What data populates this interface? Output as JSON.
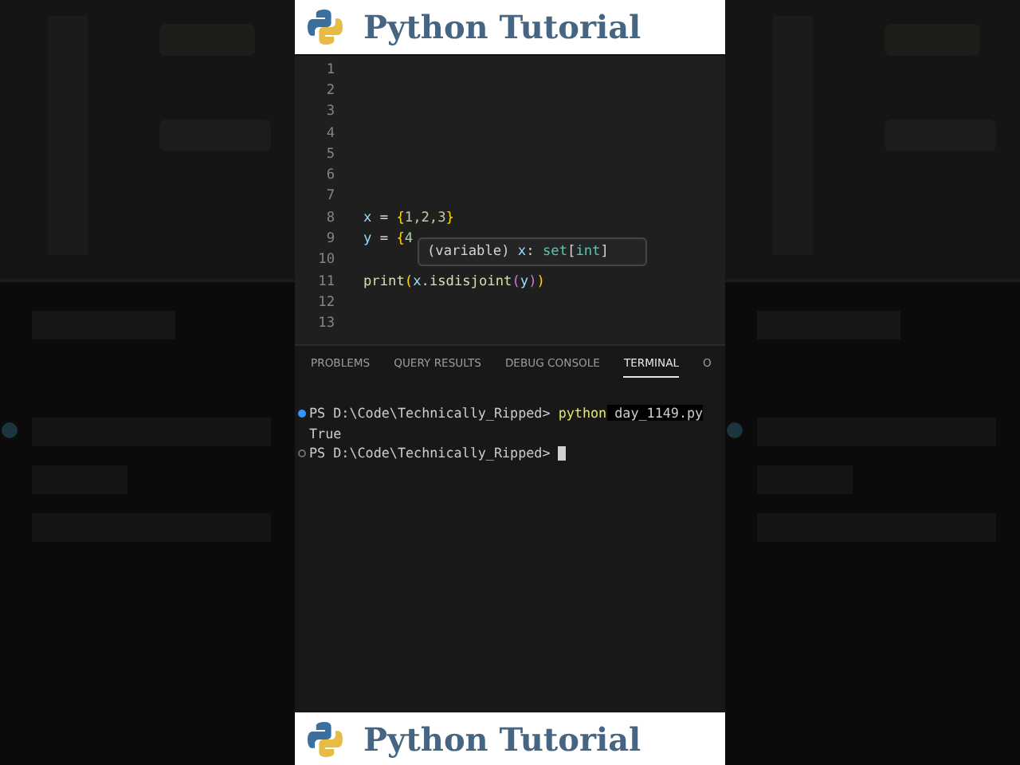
{
  "banner_top": {
    "title": "Python Tutorial"
  },
  "editor": {
    "lines": [
      {
        "number": "1"
      },
      {
        "number": "2"
      },
      {
        "number": "3"
      },
      {
        "number": "4"
      },
      {
        "number": "5"
      },
      {
        "number": "6"
      },
      {
        "number": "7"
      },
      {
        "number": "8",
        "tokens": [
          {
            "text": "x",
            "kind": "var"
          },
          {
            "text": " = ",
            "kind": "op"
          },
          {
            "text": "{",
            "kind": "brace"
          },
          {
            "text": "1,2,3",
            "kind": "num"
          },
          {
            "text": "}",
            "kind": "brace"
          }
        ]
      },
      {
        "number": "9",
        "tokens": [
          {
            "text": "y",
            "kind": "var"
          },
          {
            "text": " = ",
            "kind": "op"
          },
          {
            "text": "{",
            "kind": "brace"
          },
          {
            "text": "4",
            "kind": "num"
          }
        ]
      },
      {
        "number": "10"
      },
      {
        "number": "11",
        "tokens": [
          {
            "text": "print",
            "kind": "func"
          },
          {
            "text": "(",
            "kind": "brace"
          },
          {
            "text": "x",
            "kind": "var"
          },
          {
            "text": ".",
            "kind": "op"
          },
          {
            "text": "isdisjoint",
            "kind": "func"
          },
          {
            "text": "(",
            "kind": "paren"
          },
          {
            "text": "y",
            "kind": "var"
          },
          {
            "text": ")",
            "kind": "paren"
          },
          {
            "text": ")",
            "kind": "brace"
          }
        ]
      },
      {
        "number": "12"
      },
      {
        "number": "13"
      }
    ]
  },
  "hover": {
    "tokens": [
      {
        "text": "(variable) ",
        "kind": "op"
      },
      {
        "text": "x",
        "kind": "var"
      },
      {
        "text": ": ",
        "kind": "op"
      },
      {
        "text": "set",
        "kind": "type"
      },
      {
        "text": "[",
        "kind": "op"
      },
      {
        "text": "int",
        "kind": "type"
      },
      {
        "text": "]",
        "kind": "op"
      }
    ]
  },
  "panel": {
    "tabs": [
      {
        "label": "PROBLEMS",
        "selected": false
      },
      {
        "label": "QUERY RESULTS",
        "selected": false
      },
      {
        "label": "DEBUG CONSOLE",
        "selected": false
      },
      {
        "label": "TERMINAL",
        "selected": true
      },
      {
        "label": "O",
        "selected": false
      }
    ],
    "terminal": [
      {
        "dot": {
          "filled": true
        },
        "segments": [
          {
            "text": "PS D:\\Code\\Technically_Ripped> ",
            "kind": "plain"
          },
          {
            "text": "python",
            "kind": "command"
          },
          {
            "text": " day_1149.py",
            "kind": "highlight"
          }
        ]
      },
      {
        "segments": [
          {
            "text": "True",
            "kind": "plain"
          }
        ]
      },
      {
        "dot": {
          "filled": false
        },
        "segments": [
          {
            "text": "PS D:\\Code\\Technically_Ripped> ",
            "kind": "plain"
          }
        ],
        "cursor": true
      }
    ]
  },
  "banner_bottom": {
    "title": "Python Tutorial"
  }
}
